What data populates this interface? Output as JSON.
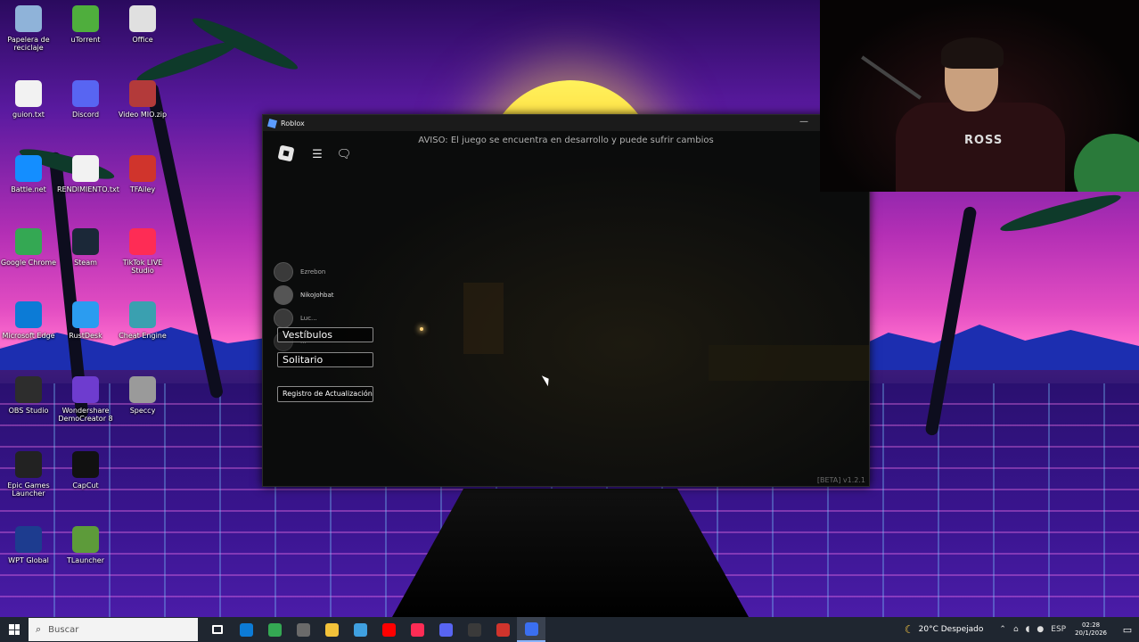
{
  "desktop": {
    "icons": [
      {
        "label": "Papelera de reciclaje",
        "color": "#8fb3d9"
      },
      {
        "label": "uTorrent",
        "color": "#4fae3d"
      },
      {
        "label": "Office",
        "color": "#e0e0e0"
      },
      {
        "label": "guion.txt",
        "color": "#f2f2f2"
      },
      {
        "label": "Discord",
        "color": "#5865f2"
      },
      {
        "label": "Video MIO.zip",
        "color": "#b33a3a"
      },
      {
        "label": "Battle.net",
        "color": "#148eff"
      },
      {
        "label": "RENDIMIENTO.txt",
        "color": "#f2f2f2"
      },
      {
        "label": "TFAiley",
        "color": "#d0342c"
      },
      {
        "label": "Google Chrome",
        "color": "#34a853"
      },
      {
        "label": "Steam",
        "color": "#1b2838"
      },
      {
        "label": "TikTok LIVE Studio",
        "color": "#fe2c55"
      },
      {
        "label": "Microsoft Edge",
        "color": "#0c7bd6"
      },
      {
        "label": "RustDesk",
        "color": "#2b9cf0"
      },
      {
        "label": "Cheat Engine",
        "color": "#3aa0b0"
      },
      {
        "label": "OBS Studio",
        "color": "#2d2d2d"
      },
      {
        "label": "Wondershare DemoCreator 8",
        "color": "#6e3ccf"
      },
      {
        "label": "Speccy",
        "color": "#9a9a9a"
      },
      {
        "label": "Epic Games Launcher",
        "color": "#222222"
      },
      {
        "label": "CapCut",
        "color": "#111111"
      },
      {
        "label": "WPT Global",
        "color": "#1d3c8f"
      },
      {
        "label": "TLauncher",
        "color": "#5d9b3a"
      }
    ]
  },
  "roblox_window": {
    "title": "Roblox",
    "minimize_glyph": "—",
    "notice": "AVISO: El juego se encuentra en desarrollo y puede sufrir cambios",
    "menu_icon": "hamburger-icon",
    "chat_icon": "chat-icon",
    "players": [
      "Ezrebon",
      "NikoJohbat",
      "Luc...",
      "..."
    ],
    "buttons": {
      "lobbies": "Vestíbulos",
      "solo": "Solitario",
      "changelog": "Registro de Actualización"
    },
    "version": "[BETA] v1.2.1"
  },
  "webcam": {
    "jersey_text": "ROSS"
  },
  "taskbar": {
    "search_placeholder": "Buscar",
    "pinned": [
      {
        "name": "task-view-icon",
        "color": "#ffffff",
        "active": false
      },
      {
        "name": "edge-icon",
        "color": "#0c7bd6",
        "active": false
      },
      {
        "name": "chrome-icon",
        "color": "#34a853",
        "active": false
      },
      {
        "name": "store-icon",
        "color": "#6a6a6a",
        "active": false
      },
      {
        "name": "file-explorer-icon",
        "color": "#f2c23a",
        "active": false
      },
      {
        "name": "app-icon",
        "color": "#3fa0e0",
        "active": false
      },
      {
        "name": "youtube-icon",
        "color": "#ff0000",
        "active": false
      },
      {
        "name": "tiktok-icon",
        "color": "#fe2c55",
        "active": false
      },
      {
        "name": "discord-icon",
        "color": "#5865f2",
        "active": false
      },
      {
        "name": "obs-icon",
        "color": "#3a3a3a",
        "active": false
      },
      {
        "name": "tfailey-icon",
        "color": "#d0342c",
        "active": false
      },
      {
        "name": "roblox-icon",
        "color": "#3b6ff0",
        "active": true
      }
    ],
    "weather": "20°C  Despejado",
    "language": "ESP",
    "time": "02:28",
    "date": "20/1/2026"
  }
}
